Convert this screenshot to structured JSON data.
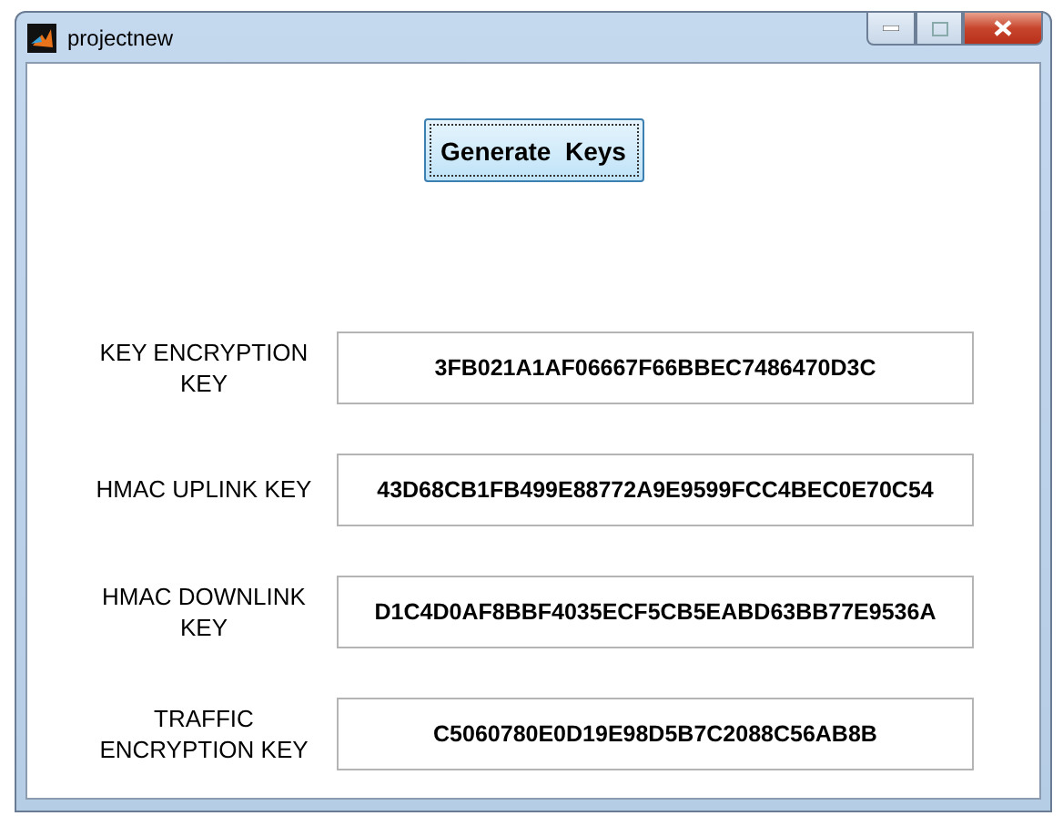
{
  "window": {
    "title": "projectnew"
  },
  "generate_button": {
    "label": "Generate  Keys"
  },
  "keys": [
    {
      "label": "KEY ENCRYPTION KEY",
      "value": "3FB021A1AF06667F66BBEC7486470D3C"
    },
    {
      "label": "HMAC UPLINK KEY",
      "value": "43D68CB1FB499E88772A9E9599FCC4BEC0E70C54"
    },
    {
      "label": "HMAC DOWNLINK KEY",
      "value": "D1C4D0AF8BBF4035ECF5CB5EABD63BB77E9536A"
    },
    {
      "label": "TRAFFIC ENCRYPTION KEY",
      "value": "C5060780E0D19E98D5B7C2088C56AB8B"
    }
  ]
}
